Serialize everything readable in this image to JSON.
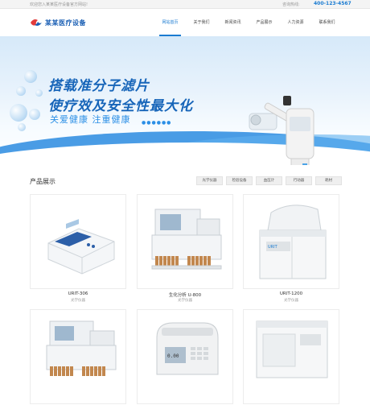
{
  "topbar": {
    "welcome": "欢迎您入某某医疗设备官方网站!",
    "hotline_label": "咨询热线:",
    "hotline": "400-123-4567"
  },
  "header": {
    "logo_text": "某某医疗设备",
    "nav": [
      {
        "label": "网站首页",
        "active": true
      },
      {
        "label": "关于我们",
        "active": false
      },
      {
        "label": "新闻资讯",
        "active": false
      },
      {
        "label": "产品展示",
        "active": false
      },
      {
        "label": "人力资源",
        "active": false
      },
      {
        "label": "联系我们",
        "active": false
      }
    ]
  },
  "banner": {
    "headline1": "搭载准分子滤片",
    "headline2": "使疗效及安全性最大化",
    "subline": "关爱健康  注重健康",
    "dots": "●●●●●●"
  },
  "products": {
    "title": "产品展示",
    "filters": [
      "光学仪器",
      "检验设备",
      "血压计",
      "行动器",
      "耗材"
    ],
    "items": [
      {
        "name": "URIT-306",
        "category": "光学仪器"
      },
      {
        "name": "生化分析 U-800",
        "category": "光学仪器"
      },
      {
        "name": "URIT-1200",
        "category": "光学仪器"
      },
      {
        "name": "",
        "category": ""
      },
      {
        "name": "",
        "category": ""
      },
      {
        "name": "",
        "category": ""
      }
    ]
  },
  "colors": {
    "accent": "#1a7bd1",
    "brand": "#1765b9"
  }
}
